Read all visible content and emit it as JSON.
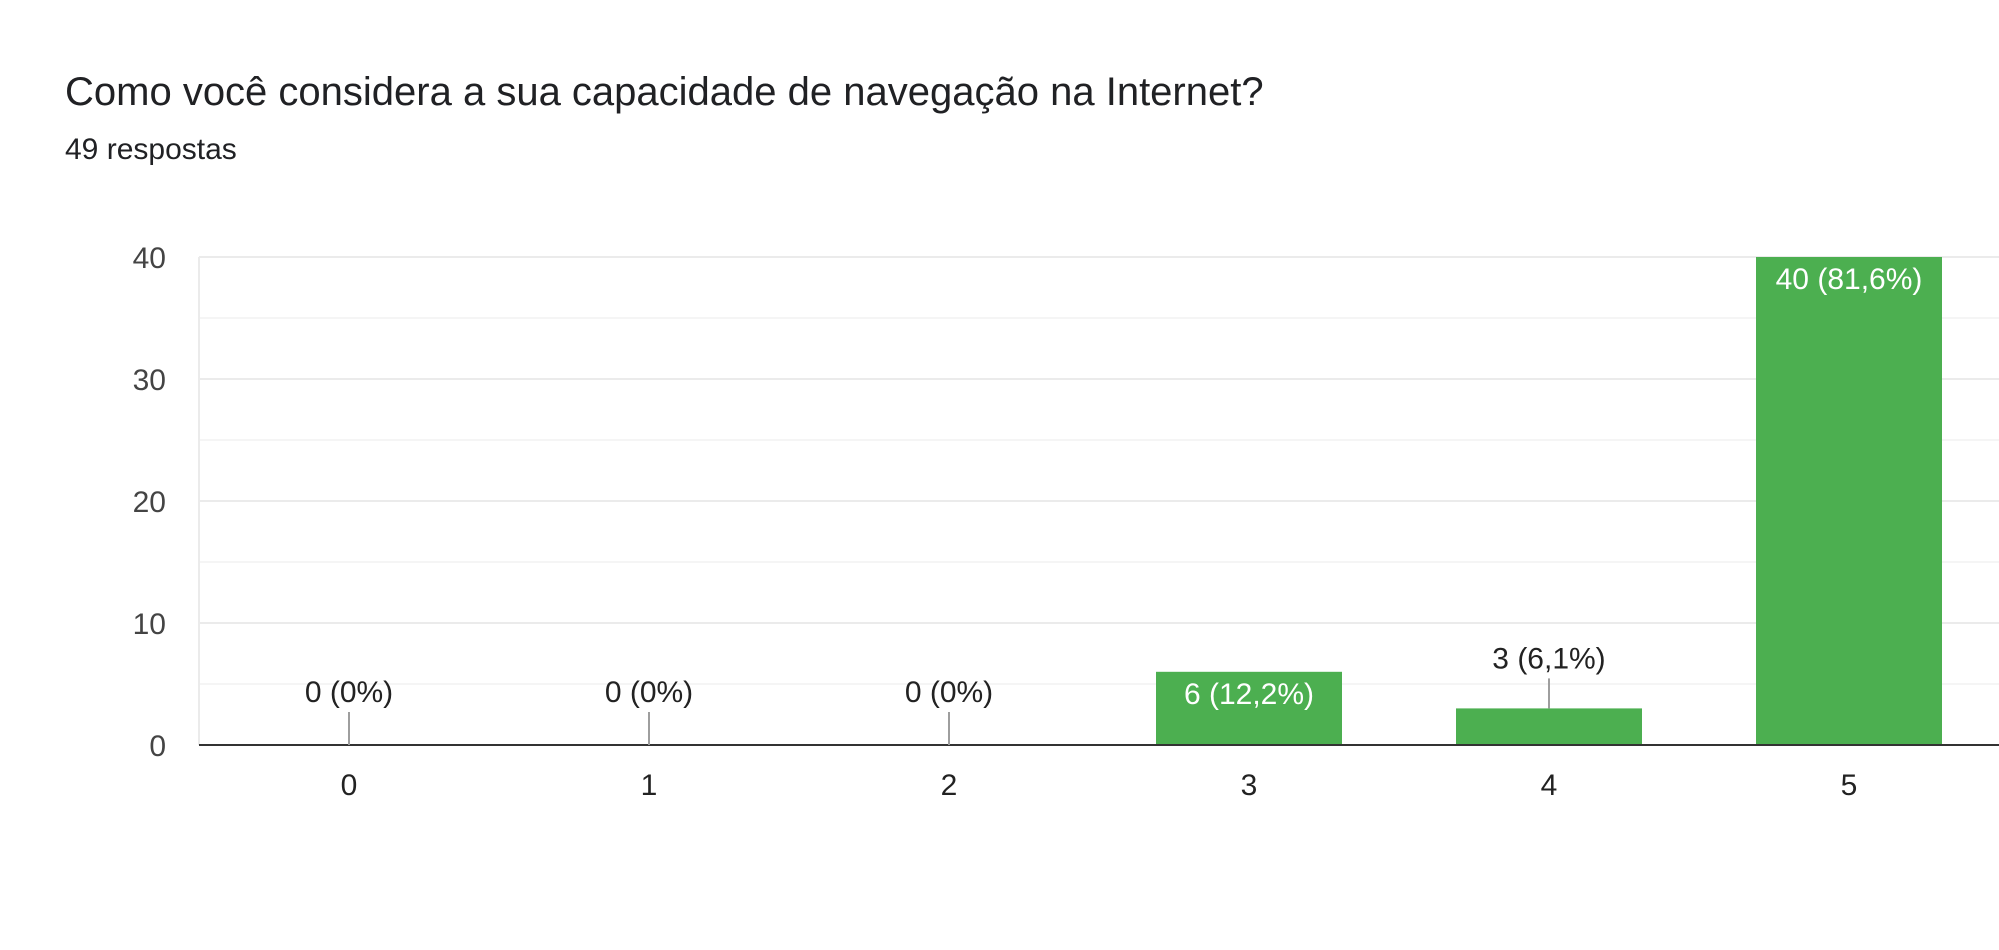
{
  "header": {
    "title": "Como você considera a sua capacidade de navegação na Internet?",
    "responses": "49 respostas"
  },
  "colors": {
    "bar": "#4caf50",
    "grid_major": "#ebebeb",
    "grid_minor": "#f5f5f5",
    "axis": "#333333",
    "label_inside": "#ffffff",
    "label_outside": "#222222",
    "leader": "#9e9e9e"
  },
  "chart_data": {
    "type": "bar",
    "categories": [
      "0",
      "1",
      "2",
      "3",
      "4",
      "5"
    ],
    "values": [
      0,
      0,
      0,
      6,
      3,
      40
    ],
    "data_labels": [
      "0 (0%)",
      "0 (0%)",
      "0 (0%)",
      "6 (12,2%)",
      "3 (6,1%)",
      "40 (81,6%)"
    ],
    "yticks": [
      "0",
      "10",
      "20",
      "30",
      "40"
    ],
    "ylim": [
      0,
      40
    ],
    "grid": true,
    "legend": "none"
  }
}
